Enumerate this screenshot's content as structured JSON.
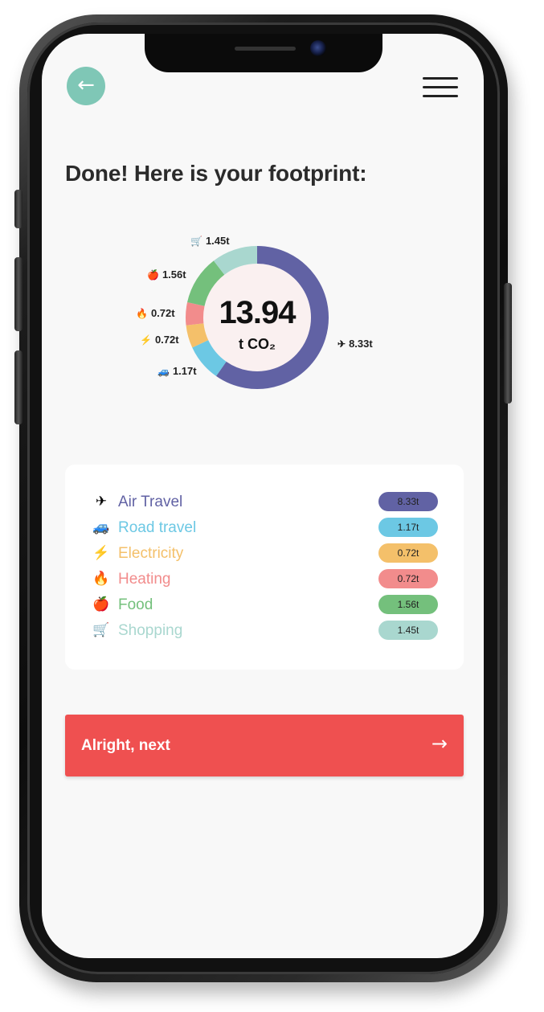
{
  "header": {
    "back_icon": "←",
    "menu_icon": "hamburger-menu"
  },
  "title": "Done! Here is your footprint:",
  "total": {
    "value": "13.94",
    "unit": "t CO₂"
  },
  "chart_data": {
    "type": "donut",
    "total": 13.94,
    "unit": "t CO₂",
    "series": [
      {
        "name": "Air Travel",
        "value": 8.33,
        "label": "8.33t",
        "color": "#6162a4",
        "icon": "✈"
      },
      {
        "name": "Road travel",
        "value": 1.17,
        "label": "1.17t",
        "color": "#6cc8e4",
        "icon": "🚙"
      },
      {
        "name": "Electricity",
        "value": 0.72,
        "label": "0.72t",
        "color": "#f4c06a",
        "icon": "⚡"
      },
      {
        "name": "Heating",
        "value": 0.72,
        "label": "0.72t",
        "color": "#f28c8c",
        "icon": "🔥"
      },
      {
        "name": "Food",
        "value": 1.56,
        "label": "1.56t",
        "color": "#74c07c",
        "icon": "🍎"
      },
      {
        "name": "Shopping",
        "value": 1.45,
        "label": "1.45t",
        "color": "#a9d7cf",
        "icon": "🛒"
      }
    ]
  },
  "legend": [
    {
      "name": "Air Travel",
      "value": "8.33t",
      "color": "#6162a4",
      "icon": "✈"
    },
    {
      "name": "Road travel",
      "value": "1.17t",
      "color": "#6cc8e4",
      "icon": "🚙"
    },
    {
      "name": "Electricity",
      "value": "0.72t",
      "color": "#f4c06a",
      "icon": "⚡"
    },
    {
      "name": "Heating",
      "value": "0.72t",
      "color": "#f28c8c",
      "icon": "🔥"
    },
    {
      "name": "Food",
      "value": "1.56t",
      "color": "#74c07c",
      "icon": "🍎"
    },
    {
      "name": "Shopping",
      "value": "1.45t",
      "color": "#a9d7cf",
      "icon": "🛒"
    }
  ],
  "next_button": {
    "label": "Alright, next",
    "arrow": "→"
  }
}
